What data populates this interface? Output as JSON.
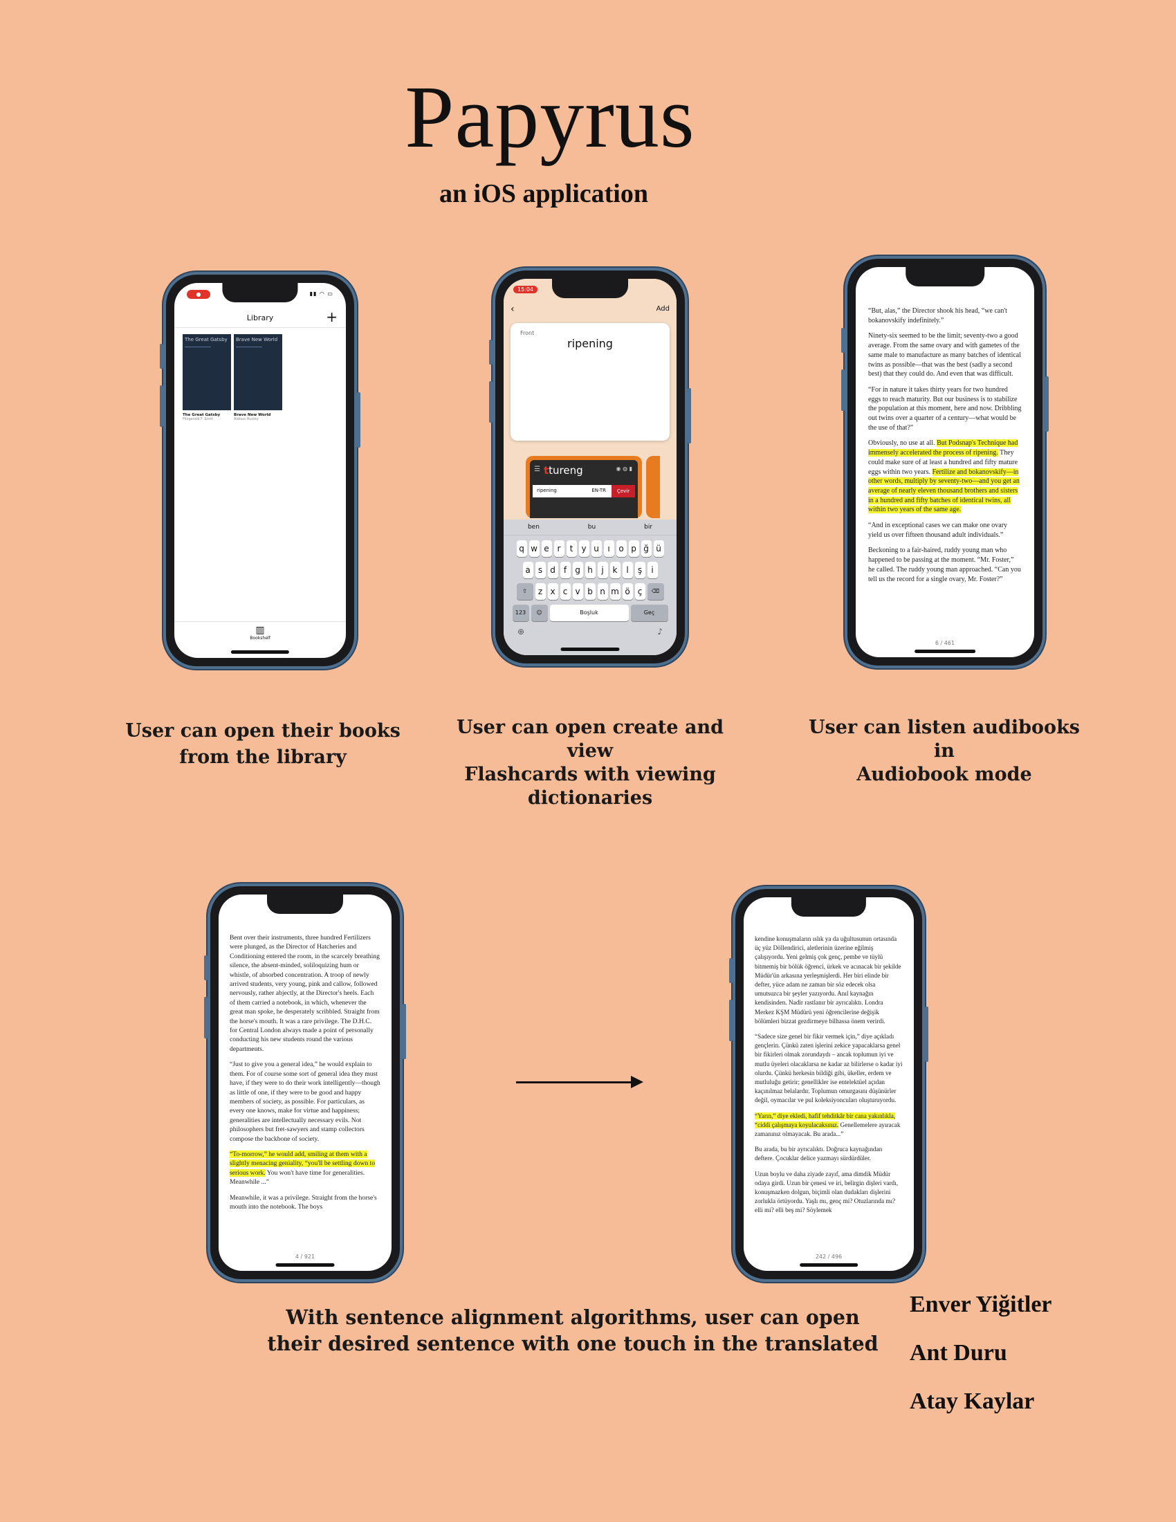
{
  "header": {
    "title": "Papyrus",
    "subtitle": "an iOS application"
  },
  "captions": {
    "library": [
      "User can open their books",
      "from the library"
    ],
    "flashcards": [
      "User can open create and view",
      "Flashcards with viewing",
      "dictionaries"
    ],
    "audiobook": [
      "User can listen audibooks in",
      "Audiobook mode"
    ],
    "alignment": [
      "With sentence alignment algorithms, user can open",
      "their  desired sentence with one touch in the translated"
    ]
  },
  "authors": [
    "Enver Yiğitler",
    "Ant Duru",
    "Atay Kaylar"
  ],
  "library_screen": {
    "title": "Library",
    "add_icon": "plus-icon",
    "books": [
      {
        "cover_title": "The Great Gatsby",
        "title": "The Great Gatsby",
        "author": "Fitzgerald F. Scott"
      },
      {
        "cover_title": "Brave New World",
        "title": "Brave New World",
        "author": "Aldous Huxley"
      }
    ],
    "tab_label": "Bookshelf",
    "tab_icon": "books-icon"
  },
  "flashcard_screen": {
    "time": "15:04",
    "nav_action": "Add",
    "card_side": "Front",
    "card_word": "ripening",
    "dictionary_name": "tureng",
    "search_value": "ripening",
    "lang": "EN-TR",
    "go_label": "Çevir",
    "suggestions": [
      "ben",
      "bu",
      "bir"
    ],
    "keys_row1": [
      "q",
      "w",
      "e",
      "r",
      "t",
      "y",
      "u",
      "ı",
      "o",
      "p",
      "ğ",
      "ü"
    ],
    "keys_row2": [
      "a",
      "s",
      "d",
      "f",
      "g",
      "h",
      "j",
      "k",
      "l",
      "ş",
      "i"
    ],
    "keys_row3": [
      "z",
      "x",
      "c",
      "v",
      "b",
      "n",
      "m",
      "ö",
      "ç"
    ],
    "key_123": "123",
    "key_space": "Boşluk",
    "key_return": "Geç"
  },
  "audiobook_screen": {
    "paragraphs": [
      "“But, alas,” the Director shook his head, “we can't bokanovskify indefinitely.”",
      "Ninety-six seemed to be the limit; seventy-two a good average. From the same ovary and with gametes of the same male to manufacture as many batches of identical twins as possible—that was the best (sadly a second best) that they could do. And even that was difficult.",
      "“For in nature it takes thirty years for two hundred eggs to reach maturity. But our business is to stabilize the population at this moment, here and now. Dribbling out twins over a quarter of a century—what would be the use of that?”",
      "Obviously, no use at all.",
      "But Podsnap's Technique had immensely accelerated the process of ripening.",
      "They could make sure of at least a hundred and fifty mature eggs within two years.",
      "Fertilize and bokanovskify—in other words, multiply by seventy-two—and you get an average of nearly eleven thousand brothers and sisters in a hundred and fifty batches of identical twins, all within two years of the same age.",
      "“And in exceptional cases we can make one ovary yield us over fifteen thousand adult individuals.”",
      "Beckoning to a fair-haired, ruddy young man who happened to be passing at the moment. “Mr. Foster,” he called. The ruddy young man approached. “Can you tell us the record for a single ovary, Mr. Foster?”"
    ],
    "page": "6 / 461"
  },
  "english_screen": {
    "paragraphs": [
      "Bent over their instruments, three hundred Fertilizers were plunged, as the Director of Hatcheries and Conditioning entered the room, in the scarcely breathing silence, the absent-minded, soliloquizing hum or whistle, of absorbed concentration. A troop of newly arrived students, very young, pink and callow, followed nervously, rather abjectly, at the Director's heels. Each of them carried a notebook, in which, whenever the great man spoke, he desperately scribbled. Straight from the horse's mouth. It was a rare privilege. The D.H.C. for Central London always made a point of personally conducting his new students round the various departments.",
      "“Just to give you a general idea,” he would explain to them. For of course some sort of general idea they must have, if they were to do their work intelligently—though as little of one, if they were to be good and happy members of society, as possible. For particulars, as every one knows, make for virtue and happiness; generalities are intellectually necessary evils. Not philosophers but fret-sawyers and stamp collectors compose the backbone of society.",
      "“To-morrow,” he would add, smiling at them with a slightly menacing geniality, “you'll be settling down to serious work.",
      "You won't have time for generalities. Meanwhile ...”",
      "Meanwhile, it was a privilege. Straight from the horse's mouth into the notebook. The boys"
    ],
    "page": "4 / 921"
  },
  "turkish_screen": {
    "paragraphs": [
      "kendine konuşmaların ıslık ya da uğultusunun ortasında üç yüz Döllendirici, aletlerinin üzerine eğilmiş çalışıyordu. Yeni gelmiş çok genç, pembe ve tüylü bitmemiş bir bölük öğrenci, ürkek ve acınacak bir şekilde Müdür'ün arkasına yerleşmişlerdi. Her biri elinde bir defter, yüce adam ne zaman bir söz edecek olsa umutsuzca bir şeyler yazıyordu. Anıl kaynağın kendisinden. Nadir rastlanır bir ayrıcalıktı. Londra Merkez KŞM Müdürü yeni öğrencilerine değişik bölümleri bizzat gezdirmeye bilhassa önem verirdi.",
      "“Sadece size genel bir fikir vermek için,” diye açıkladı gençlerin. Çünkü zaten işlerini zekice yapacaklarsa genel bir fikirleri olmak zorundaydı – ancak toplumun iyi ve mutlu üyeleri olacaklarsa ne kadar az bilirlerse o kadar iyi olurdu. Çünkü herkesin bildiği gibi, ükeller, erdem ve mutluluğu getirir; genellikler ise entelektüel açıdan kaçınılmaz belalardır. Toplumun omurgasını düşünürler değil, oymacılar ve pul koleksiyoncuları oluşturuyordu.",
      "“Yarın,” diye ekledi, hafif tehditkâr bir cana yakınlıkla, “ciddi çalışmaya koyulacaksınız.",
      "Genellemelere ayıracak zamanınız olmayacak. Bu arada...”",
      "Bu arada, bu bir ayrıcalıktı. Doğruca kaynağından deftere. Çocuklar delice yazmayı sürdürdüler.",
      "Uzun boylu ve daha ziyade zayıf, ama dimdik Müdür odaya girdi. Uzun bir çenesi ve iri, belirgin dişleri vardı, konuşmazken dolgun, biçimli olan dudakları dişlerini zorlukla örtüyordu. Yaşlı mı, genç mi? Otuzlarında mı? elli mi? elli beş mi? Söylemek"
    ],
    "page": "242 / 496"
  }
}
